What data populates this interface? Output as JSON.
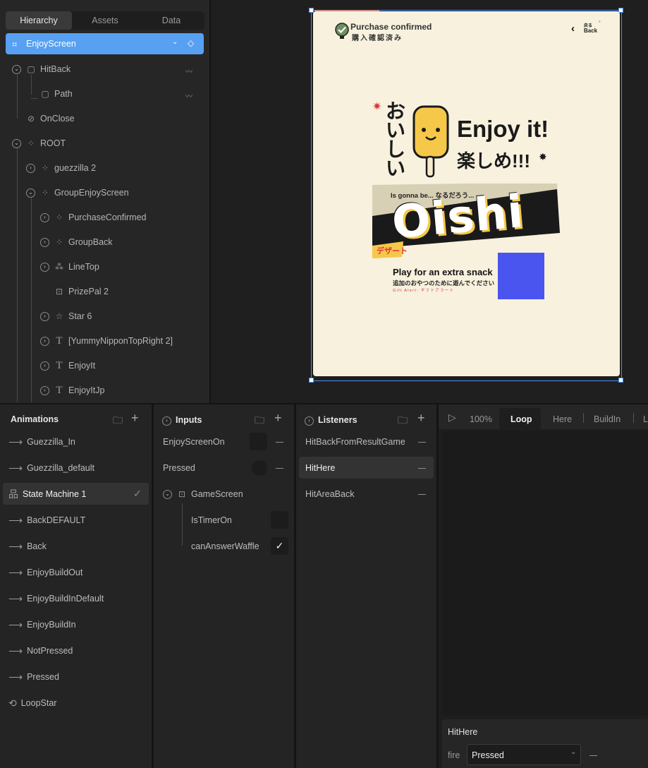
{
  "hierarchy": {
    "tabs": [
      "Hierarchy",
      "Assets",
      "Data"
    ],
    "selected": "EnjoyScreen",
    "items": [
      "HitBack",
      "Path",
      "OnClose",
      "ROOT",
      "guezzilla 2",
      "GroupEnjoyScreen",
      "PurchaseConfirmed",
      "GroupBack",
      "LineTop",
      "PrizePal 2",
      "Star 6",
      "[YummyNipponTopRight 2]",
      "EnjoyIt",
      "EnjoyItJp"
    ]
  },
  "artboard": {
    "purchase_en": "Purchase confirmed",
    "purchase_jp": "購入確認済み",
    "back_jp": "戻る",
    "back_en": "Back",
    "oishii": "おいしい",
    "enjoy": "Enjoy it!",
    "enjoy_jp": "楽しめ!!!",
    "gonna": "Is gonna be...  なるだろう...",
    "oishi": "Oishi",
    "dessert": "デザート",
    "play": "Play for an extra snack",
    "play_jp": "追加のおやつのために遊んでください",
    "gift": "Gift Alert: ギフトアラート"
  },
  "animations": {
    "title": "Animations",
    "items": [
      "Guezzilla_In",
      "Guezzilla_default",
      "State Machine 1",
      "BackDEFAULT",
      "Back",
      "EnjoyBuildOut",
      "EnjoyBuildInDefault",
      "EnjoyBuildIn",
      "NotPressed",
      "Pressed",
      "LoopStar"
    ]
  },
  "inputs": {
    "title": "Inputs",
    "items": [
      "EnjoyScreenOn",
      "Pressed",
      "GameScreen",
      "IsTimerOn",
      "canAnswerWaffle"
    ]
  },
  "listeners": {
    "title": "Listeners",
    "items": [
      "HitBackFromResultGame",
      "HitHere",
      "HitAreaBack"
    ]
  },
  "timeline": {
    "zoom": "100%",
    "tabs": [
      "Loop",
      "Here",
      "BuildIn",
      "L"
    ],
    "listener_name": "HitHere",
    "fire_label": "fire",
    "fire_value": "Pressed"
  },
  "colors": {
    "selection": "#57a0f2",
    "accent_square": "#4a55f0",
    "artboard": "#f7f1de"
  }
}
